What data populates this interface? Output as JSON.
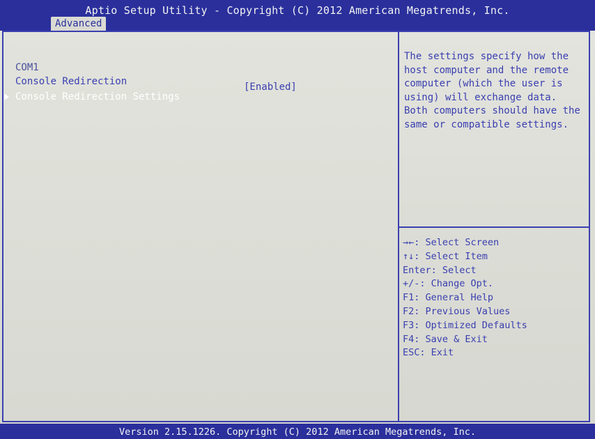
{
  "header": {
    "title": "Aptio Setup Utility - Copyright (C) 2012 American Megatrends, Inc.",
    "active_tab": "Advanced"
  },
  "main": {
    "section_label": "COM1",
    "items": [
      {
        "label": "Console Redirection",
        "value": "[Enabled]"
      },
      {
        "label": "Console Redirection Settings",
        "value": ""
      }
    ]
  },
  "help": {
    "lines": [
      "The settings specify how the",
      "host computer and the remote",
      "computer (which the user is",
      "using) will exchange data.",
      "Both computers should have the",
      "same or compatible settings."
    ]
  },
  "keys": {
    "lines": [
      "→←: Select Screen",
      "↑↓: Select Item",
      "Enter: Select",
      "+/-: Change Opt.",
      "F1: General Help",
      "F2: Previous Values",
      "F3: Optimized Defaults",
      "F4: Save & Exit",
      "ESC: Exit"
    ]
  },
  "footer": {
    "text": "Version 2.15.1226. Copyright (C) 2012 American Megatrends, Inc."
  }
}
